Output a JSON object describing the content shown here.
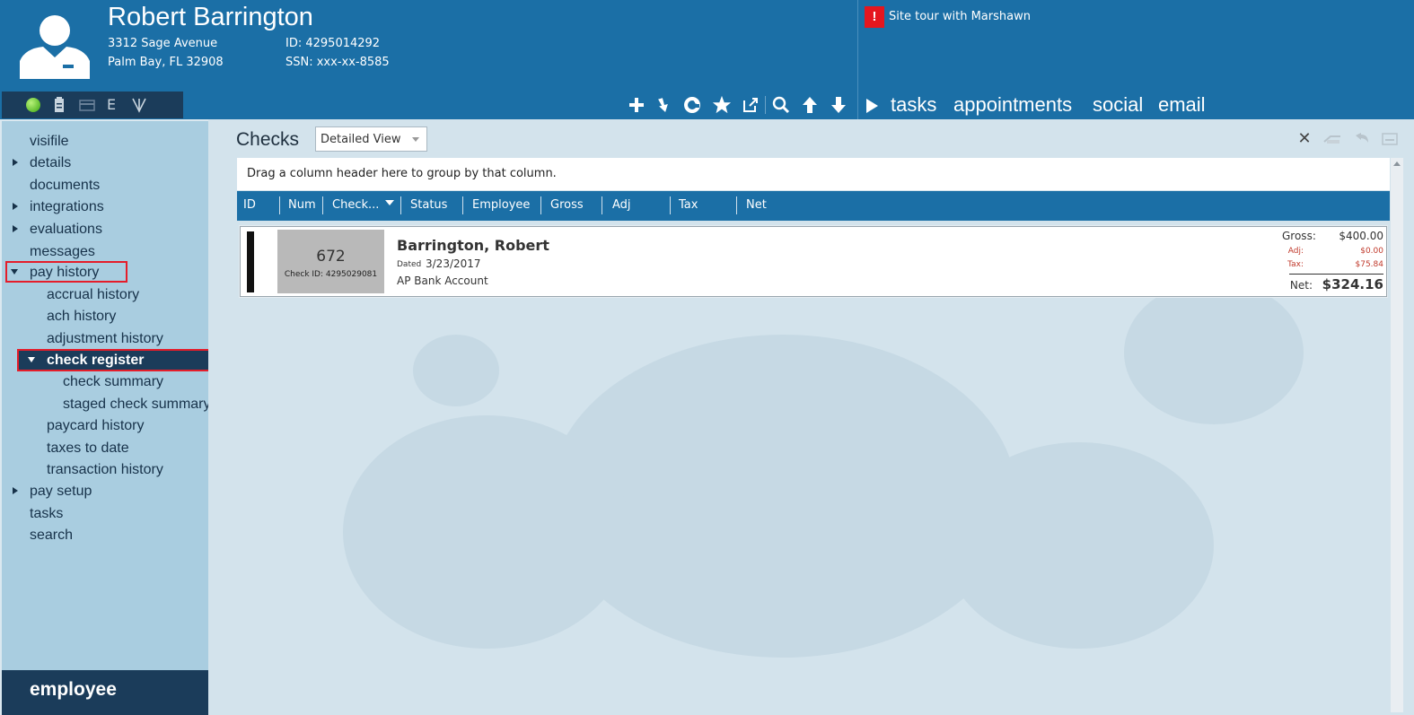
{
  "header": {
    "employee_name": "Robert Barrington",
    "address_line1": "3312 Sage Avenue",
    "address_line2": "Palm Bay, FL 32908",
    "id_text": "ID: 4295014292",
    "ssn_text": "SSN: xxx-xx-8585",
    "alert_icon": "!",
    "alert_text": "Site tour with Marshawn",
    "status_icons": [
      "status-online-icon",
      "clipboard-icon",
      "card-icon",
      "e-icon",
      "medical-icon"
    ],
    "status_e": "E",
    "toolbar_icons": [
      "plus-icon",
      "arrow-down-right-icon",
      "refresh-icon",
      "star-icon",
      "external-link-icon",
      "search-icon",
      "arrow-up-icon",
      "arrow-down-icon"
    ],
    "nav": {
      "tasks": "tasks",
      "appointments": "appointments",
      "social": "social",
      "email": "email"
    }
  },
  "sidebar": {
    "items": {
      "visifile": "visifile",
      "details": "details",
      "documents": "documents",
      "integrations": "integrations",
      "evaluations": "evaluations",
      "messages": "messages",
      "pay_history": "pay history",
      "accrual_history": "accrual history",
      "ach_history": "ach history",
      "adjustment_history": "adjustment history",
      "check_register": "check register",
      "check_summary": "check summary",
      "staged_check_summary": "staged check summary",
      "paycard_history": "paycard history",
      "taxes_to_date": "taxes to date",
      "transaction_history": "transaction history",
      "pay_setup": "pay setup",
      "tasks": "tasks",
      "search": "search"
    },
    "footer": "employee"
  },
  "main": {
    "title": "Checks",
    "view_select": "Detailed View",
    "group_hint": "Drag a column header here to group by that column.",
    "columns": [
      "ID",
      "Num",
      "Check...",
      "Status",
      "Employee",
      "Gross",
      "Adj",
      "Tax",
      "Net"
    ],
    "check": {
      "number": "672",
      "check_id": "Check ID: 4295029081",
      "employee": "Barrington, Robert",
      "dated_label": "Dated",
      "dated": "3/23/2017",
      "account": "AP Bank Account",
      "gross_label": "Gross:",
      "gross": "$400.00",
      "adj_label": "Adj:",
      "adj": "$0.00",
      "tax_label": "Tax:",
      "tax": "$75.84",
      "net_label": "Net:",
      "net": "$324.16"
    }
  },
  "colors": {
    "header_blue": "#1b6fa6",
    "dark_navy": "#1b3c5a",
    "sidebar": "#a9cde0",
    "highlight_red": "#e51d2a"
  }
}
